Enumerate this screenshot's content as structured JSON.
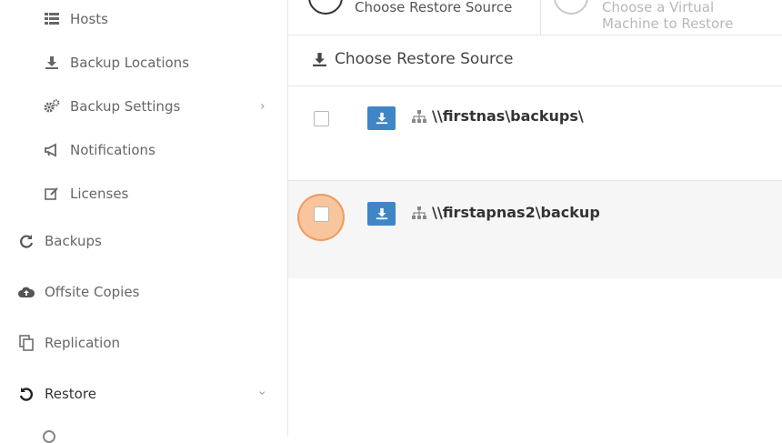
{
  "sidebar": {
    "items": [
      {
        "label": "Hosts",
        "icon": "list-icon"
      },
      {
        "label": "Backup Locations",
        "icon": "download-icon"
      },
      {
        "label": "Backup Settings",
        "icon": "gears-icon"
      },
      {
        "label": "Notifications",
        "icon": "bullhorn-icon"
      },
      {
        "label": "Licenses",
        "icon": "edit-icon"
      },
      {
        "label": "Backups",
        "icon": "refresh-icon"
      },
      {
        "label": "Offsite Copies",
        "icon": "cloud-upload-icon"
      },
      {
        "label": "Replication",
        "icon": "copy-icon"
      },
      {
        "label": "Restore",
        "icon": "undo-icon"
      }
    ]
  },
  "wizard": {
    "step1": "Choose Restore Source",
    "step2_line1": "Choose a Virtual",
    "step2_line2": "Machine to Restore"
  },
  "section": {
    "title": "Choose Restore Source"
  },
  "sources": [
    {
      "path": "\\\\firstnas\\backups\\",
      "checked": false
    },
    {
      "path": "\\\\firstapnas2\\backup",
      "checked": false
    }
  ],
  "colors": {
    "accent": "#3f86c6",
    "click_highlight": "#f9b27a",
    "row_alt": "#f6f6f6"
  }
}
